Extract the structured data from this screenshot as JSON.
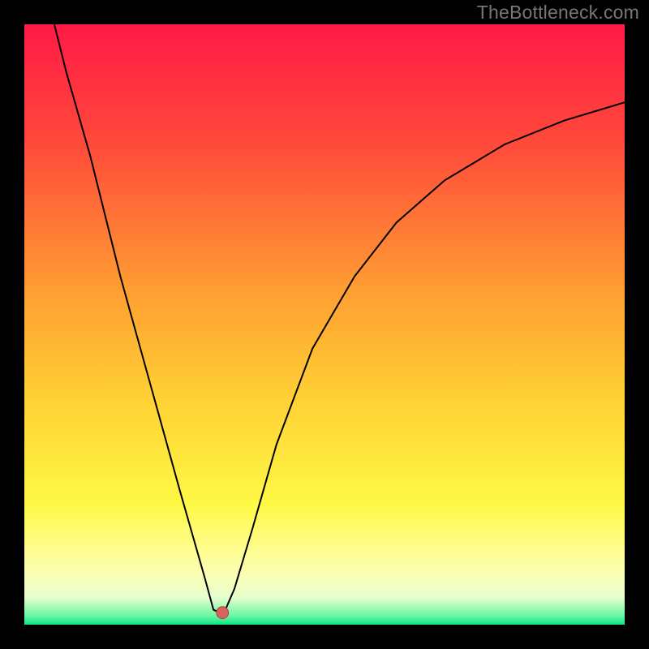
{
  "watermark": "TheBottleneck.com",
  "chart_data": {
    "type": "line",
    "title": "",
    "xlabel": "",
    "ylabel": "",
    "xlim": [
      0,
      100
    ],
    "ylim": [
      0,
      100
    ],
    "background_gradient": {
      "stops": [
        {
          "offset": 0.0,
          "color": "#ff1a47"
        },
        {
          "offset": 0.2,
          "color": "#ff4a3a"
        },
        {
          "offset": 0.45,
          "color": "#ffa032"
        },
        {
          "offset": 0.62,
          "color": "#ffd034"
        },
        {
          "offset": 0.8,
          "color": "#fff945"
        },
        {
          "offset": 0.91,
          "color": "#fdffb0"
        },
        {
          "offset": 0.955,
          "color": "#e7ffcf"
        },
        {
          "offset": 0.985,
          "color": "#6cf7a3"
        },
        {
          "offset": 1.0,
          "color": "#0de486"
        }
      ]
    },
    "series": [
      {
        "name": "bottleneck-curve",
        "stroke": "#000000",
        "stroke_width": 2,
        "points": [
          {
            "x": 5.0,
            "y": 100.0
          },
          {
            "x": 7.0,
            "y": 92.0
          },
          {
            "x": 11.0,
            "y": 78.0
          },
          {
            "x": 16.0,
            "y": 58.0
          },
          {
            "x": 21.0,
            "y": 40.0
          },
          {
            "x": 26.0,
            "y": 22.0
          },
          {
            "x": 30.0,
            "y": 8.0
          },
          {
            "x": 31.5,
            "y": 2.5
          },
          {
            "x": 32.5,
            "y": 2.0
          },
          {
            "x": 33.5,
            "y": 2.5
          },
          {
            "x": 35.0,
            "y": 6.0
          },
          {
            "x": 38.0,
            "y": 16.0
          },
          {
            "x": 42.0,
            "y": 30.0
          },
          {
            "x": 48.0,
            "y": 46.0
          },
          {
            "x": 55.0,
            "y": 58.0
          },
          {
            "x": 62.0,
            "y": 67.0
          },
          {
            "x": 70.0,
            "y": 74.0
          },
          {
            "x": 80.0,
            "y": 80.0
          },
          {
            "x": 90.0,
            "y": 84.0
          },
          {
            "x": 100.0,
            "y": 87.0
          }
        ]
      }
    ],
    "marker": {
      "name": "optimum-point",
      "x": 33.0,
      "y": 2.0,
      "r": 1.0,
      "fill": "#d9625d",
      "stroke": "#a84440"
    }
  }
}
